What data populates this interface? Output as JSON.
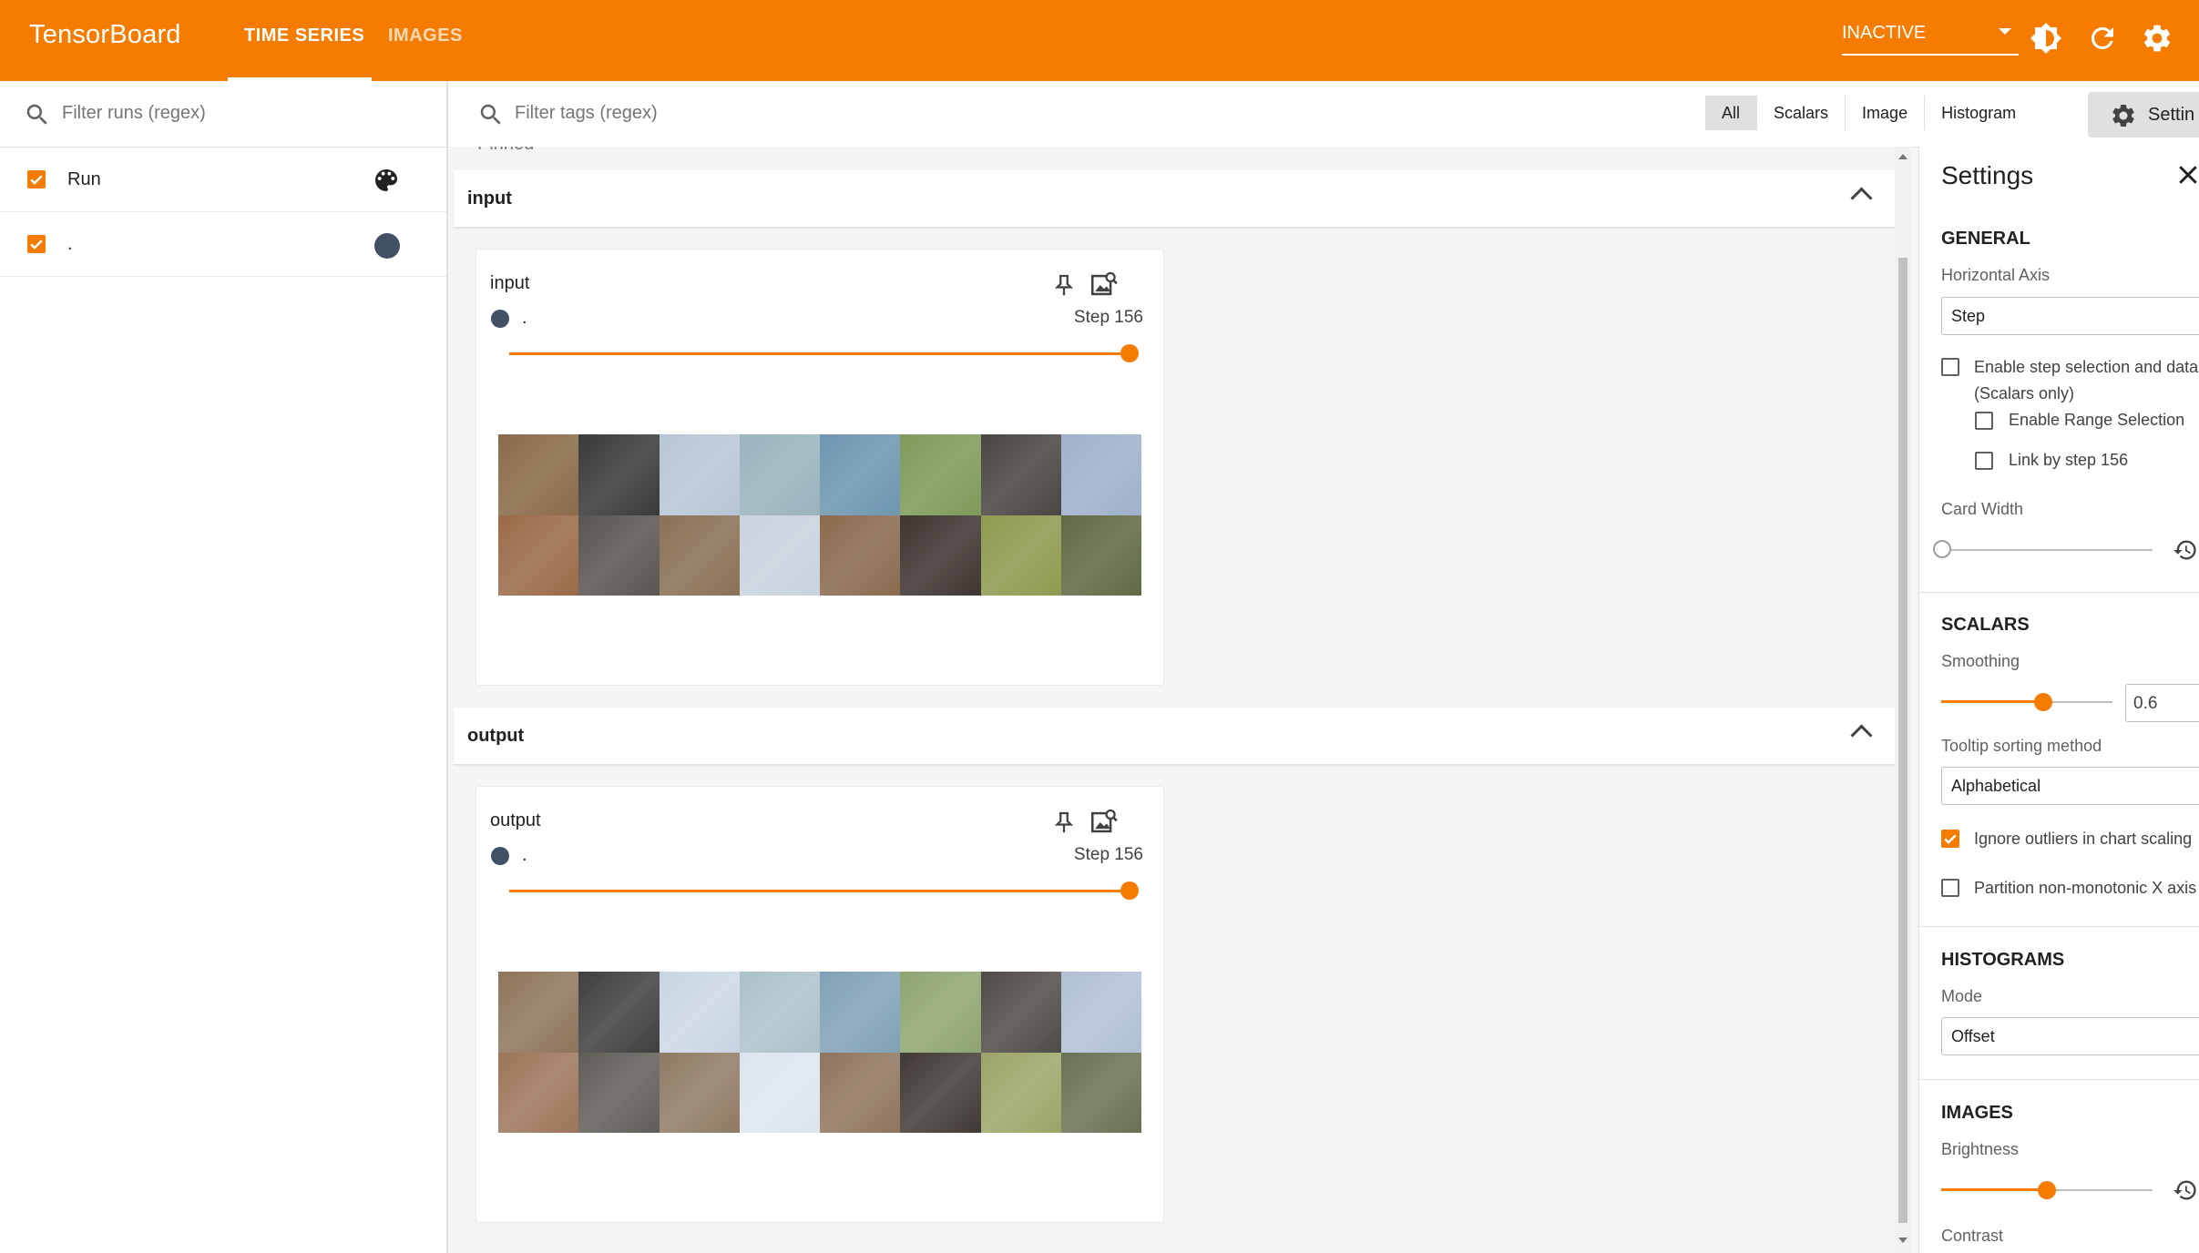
{
  "header": {
    "brand": "TensorBoard",
    "tabs": [
      {
        "label": "TIME SERIES"
      },
      {
        "label": "IMAGES"
      }
    ],
    "status_select": "INACTIVE"
  },
  "sidebar": {
    "filter_placeholder": "Filter runs (regex)",
    "runs": [
      {
        "label": "Run",
        "checked": true
      },
      {
        "label": ".",
        "checked": true,
        "color": "#425066"
      }
    ]
  },
  "tagbar": {
    "filter_placeholder": "Filter tags (regex)",
    "types": [
      "All",
      "Scalars",
      "Image",
      "Histogram"
    ],
    "selected_type": "All",
    "settings_label": "Settin"
  },
  "main": {
    "pinned_tail": "Pinned",
    "groups": [
      {
        "title": "input",
        "card": {
          "title": "input",
          "run": ".",
          "step": "Step 156"
        }
      },
      {
        "title": "output",
        "card": {
          "title": "output",
          "run": ".",
          "step": "Step 156"
        }
      }
    ]
  },
  "settings": {
    "title": "Settings",
    "general": {
      "heading": "GENERAL",
      "axis_label": "Horizontal Axis",
      "axis_value": "Step",
      "step_selection_line1": "Enable step selection and data",
      "step_selection_line2": "(Scalars only)",
      "range_selection": "Enable Range Selection",
      "link_by_step": "Link by step 156",
      "card_width": "Card Width"
    },
    "scalars": {
      "heading": "SCALARS",
      "smoothing_label": "Smoothing",
      "smoothing_value": "0.6",
      "tooltip_label": "Tooltip sorting method",
      "tooltip_value": "Alphabetical",
      "ignore_outliers": "Ignore outliers in chart scaling",
      "partition": "Partition non-monotonic X axis"
    },
    "histograms": {
      "heading": "HISTOGRAMS",
      "mode_label": "Mode",
      "mode_value": "Offset"
    },
    "images": {
      "heading": "IMAGES",
      "brightness": "Brightness",
      "contrast": "Contrast"
    }
  },
  "colors": {
    "accent": "#f57c00",
    "run_dot": "#425066",
    "tiles_top": [
      "#8a6a4a",
      "#3a3a3a",
      "#b7c6d6",
      "#9ab3bd",
      "#6e96b0",
      "#7f9a5a",
      "#4a4540",
      "#9fb1cc"
    ],
    "tiles_bottom": [
      "#9a6a48",
      "#5a5550",
      "#8a7055",
      "#c9d3de",
      "#8b6a4e",
      "#3d3530",
      "#8f9a4f",
      "#5f6a45"
    ]
  }
}
